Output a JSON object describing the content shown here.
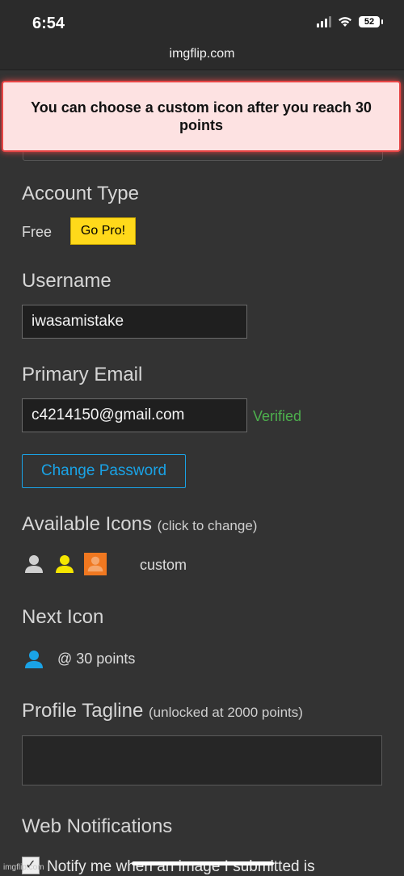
{
  "status_bar": {
    "time": "6:54",
    "battery": "52"
  },
  "browser": {
    "url": "imgflip.com"
  },
  "toast": {
    "message": "You can choose a custom icon after you reach 30 points"
  },
  "account_type": {
    "heading": "Account Type",
    "value": "Free",
    "go_pro_label": "Go Pro!"
  },
  "username": {
    "heading": "Username",
    "value": "iwasamistake"
  },
  "email": {
    "heading": "Primary Email",
    "value": "c4214150@gmail.com",
    "status": "Verified",
    "status_color": "#4db04d"
  },
  "password": {
    "button_label": "Change Password"
  },
  "available_icons": {
    "heading": "Available Icons",
    "hint": "(click to change)",
    "icons": [
      {
        "name": "person-icon",
        "color": "#d0d0d0"
      },
      {
        "name": "person-icon",
        "color": "#f5e600"
      },
      {
        "name": "person-icon",
        "color": "#f07820",
        "selected": true
      }
    ],
    "custom_label": "custom"
  },
  "next_icon": {
    "heading": "Next Icon",
    "color": "#1aa3e6",
    "points_label": "@ 30 points"
  },
  "profile_tagline": {
    "heading": "Profile Tagline",
    "hint": "(unlocked at 2000 points)",
    "value": ""
  },
  "web_notifications": {
    "heading": "Web Notifications",
    "option_label": "Notify me when an image I submitted is",
    "checked": true
  },
  "watermark": "imgflip.com"
}
